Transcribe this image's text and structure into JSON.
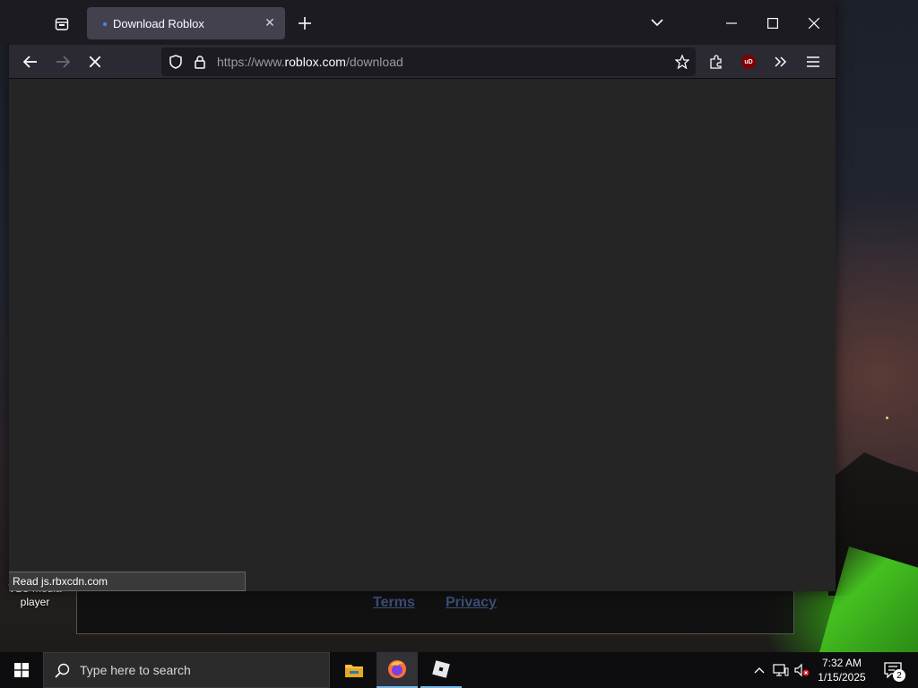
{
  "desktop": {
    "icon_label": "VLC media player"
  },
  "background_page": {
    "links": [
      "Terms",
      "Privacy"
    ]
  },
  "browser": {
    "tab": {
      "title": "Download Roblox"
    },
    "url": {
      "prefix": "https://www.",
      "domain": "roblox.com",
      "path": "/download"
    },
    "status_text": "Read js.rbxcdn.com",
    "ublock_label": "uD"
  },
  "taskbar": {
    "search_placeholder": "Type here to search",
    "time": "7:32 AM",
    "date": "1/15/2025",
    "notification_count": "2"
  },
  "colors": {
    "accent": "#76b9ed",
    "tab_active": "#42414d",
    "ublock": "#800000"
  }
}
